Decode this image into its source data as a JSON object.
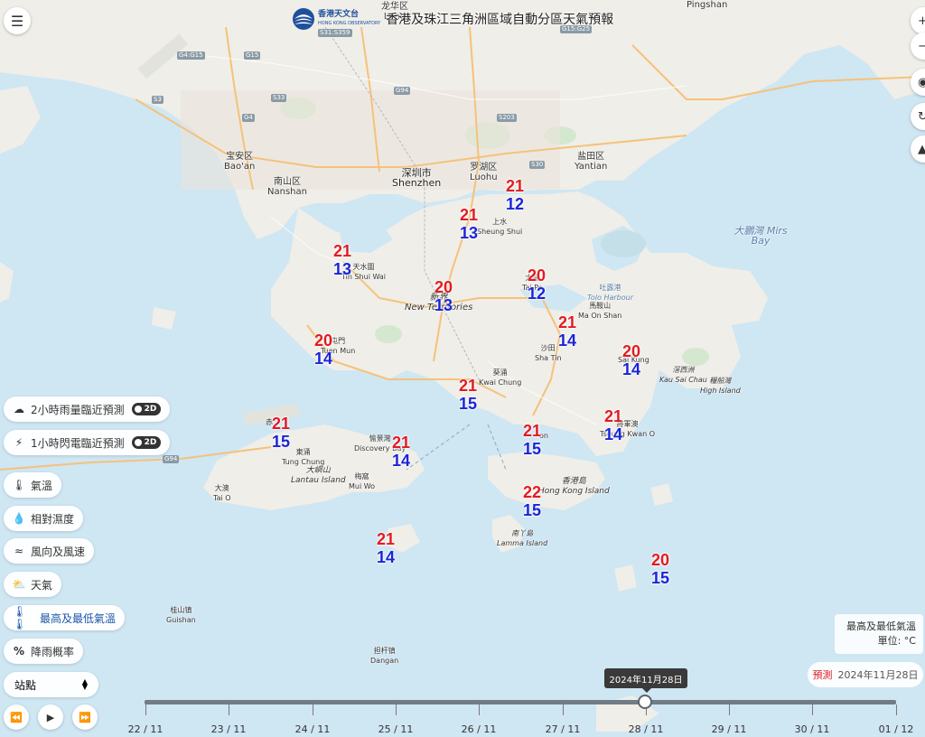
{
  "header": {
    "title": "香港及珠江三角洲區域自動分區天氣預報",
    "logo_cn": "香港天文台",
    "logo_en": "HONG KONG OBSERVATORY"
  },
  "layers": [
    {
      "label": "2小時雨量臨近預測",
      "badge": "2D",
      "icon": "rain-cloud-icon"
    },
    {
      "label": "1小時閃電臨近預測",
      "badge": "2D",
      "icon": "lightning-icon"
    },
    {
      "label": "氣溫",
      "icon": "thermometer-icon"
    },
    {
      "label": "相對濕度",
      "icon": "droplet-icon"
    },
    {
      "label": "風向及風速",
      "icon": "wind-icon"
    },
    {
      "label": "天氣",
      "icon": "weather-icon"
    },
    {
      "label": "最高及最低氣溫",
      "icon": "max-min-temp-icon",
      "active": true
    },
    {
      "label": "降雨概率",
      "icon": "percent-icon"
    }
  ],
  "station_select": {
    "value": "站點"
  },
  "legend": {
    "title": "最高及最低氣溫",
    "unit": "單位: °C"
  },
  "forecast": {
    "label": "預測",
    "date": "2024年11月28日"
  },
  "timeline": {
    "tooltip": "2024年11月28日",
    "dates": [
      "22 / 11",
      "23 / 11",
      "24 / 11",
      "25 / 11",
      "26 / 11",
      "27 / 11",
      "28 / 11",
      "29 / 11",
      "30 / 11",
      "01 / 12"
    ],
    "selected_index": 6
  },
  "temperatures": [
    {
      "hi": "21",
      "lo": "12"
    },
    {
      "hi": "21",
      "lo": "13"
    },
    {
      "hi": "21",
      "lo": "13"
    },
    {
      "hi": "20",
      "lo": "12"
    },
    {
      "hi": "20",
      "lo": "13"
    },
    {
      "hi": "20",
      "lo": "14"
    },
    {
      "hi": "21",
      "lo": "14"
    },
    {
      "hi": "20",
      "lo": "14"
    },
    {
      "hi": "21",
      "lo": "15"
    },
    {
      "hi": "21",
      "lo": "15"
    },
    {
      "hi": "21",
      "lo": "14"
    },
    {
      "hi": "21",
      "lo": "15"
    },
    {
      "hi": "21",
      "lo": "14"
    },
    {
      "hi": "22",
      "lo": "15"
    },
    {
      "hi": "21",
      "lo": "14"
    },
    {
      "hi": "20",
      "lo": "15"
    }
  ],
  "place_labels": {
    "longhua": "龙华区",
    "long": "Long",
    "pingshan": "Pingshan",
    "baoan_cn": "宝安区",
    "baoan_en": "Bao'an",
    "nanshan_cn": "南山区",
    "nanshan_en": "Nanshan",
    "shenzhen_cn": "深圳市",
    "shenzhen_en": "Shenzhen",
    "luohu_cn": "罗湖区",
    "luohu_en": "Luohu",
    "yantian_cn": "盐田区",
    "yantian_en": "Yantian",
    "mirs_bay": "大鵬灣 Mirs Bay",
    "tolo_cn": "吐露港",
    "tolo_en": "Tolo Harbour",
    "maonshan_cn": "馬鞍山",
    "maonshan_en": "Ma On Shan",
    "shatin_cn": "沙田",
    "shatin_en": "Sha Tin",
    "saikung": "Sai Kung",
    "kausaichau_cn": "滘西洲",
    "kausaichau_en": "Kau Sai Chau",
    "highisland_cn": "糧船灣",
    "highisland_en": "High Island",
    "kwaichung_cn": "葵涌",
    "kwaichung_en": "Kwai Chung",
    "newterr_cn": "新界",
    "newterr_en": "New Territories",
    "tuenmun_cn": "屯門",
    "tuenmun_en": "Tuen Mun",
    "yuenlong_cn": "天水圍",
    "yuenlong_en": "Tin Shui Wai",
    "sheungshui_cn": "上水",
    "sheungshui_en": "Sheung Shui",
    "taipo_cn": "大埔",
    "taipo_en": "Tai Po",
    "tseungkwano_cn": "將軍澳",
    "tseungkwano_en": "Tseung Kwan O",
    "discovery_cn": "愉景灣",
    "discovery_en": "Discovery Bay",
    "tungchung_cn": "東涌",
    "tungchung_en": "Tung Chung",
    "lantau_cn": "大嶼山",
    "lantau_en": "Lantau Island",
    "muiwo_cn": "梅窩",
    "muiwo_en": "Mui Wo",
    "taio_cn": "大澳",
    "taio_en": "Tai O",
    "hki_cn": "香港島",
    "hki_en": "Hong Kong Island",
    "lamma_cn": "南丫島",
    "lamma_en": "Lamma Island",
    "guishan_cn": "桂山镇",
    "guishan_en": "Guishan",
    "dangan_cn": "担杆镇",
    "dangan_en": "Dangan",
    "chek": "赤",
    "kowloon_en": "on"
  },
  "road_shields": [
    "G4:G15",
    "G15",
    "S33",
    "S3",
    "G4",
    "G94",
    "S31:S359",
    "G15:G25",
    "S30",
    "S203",
    "G94"
  ]
}
